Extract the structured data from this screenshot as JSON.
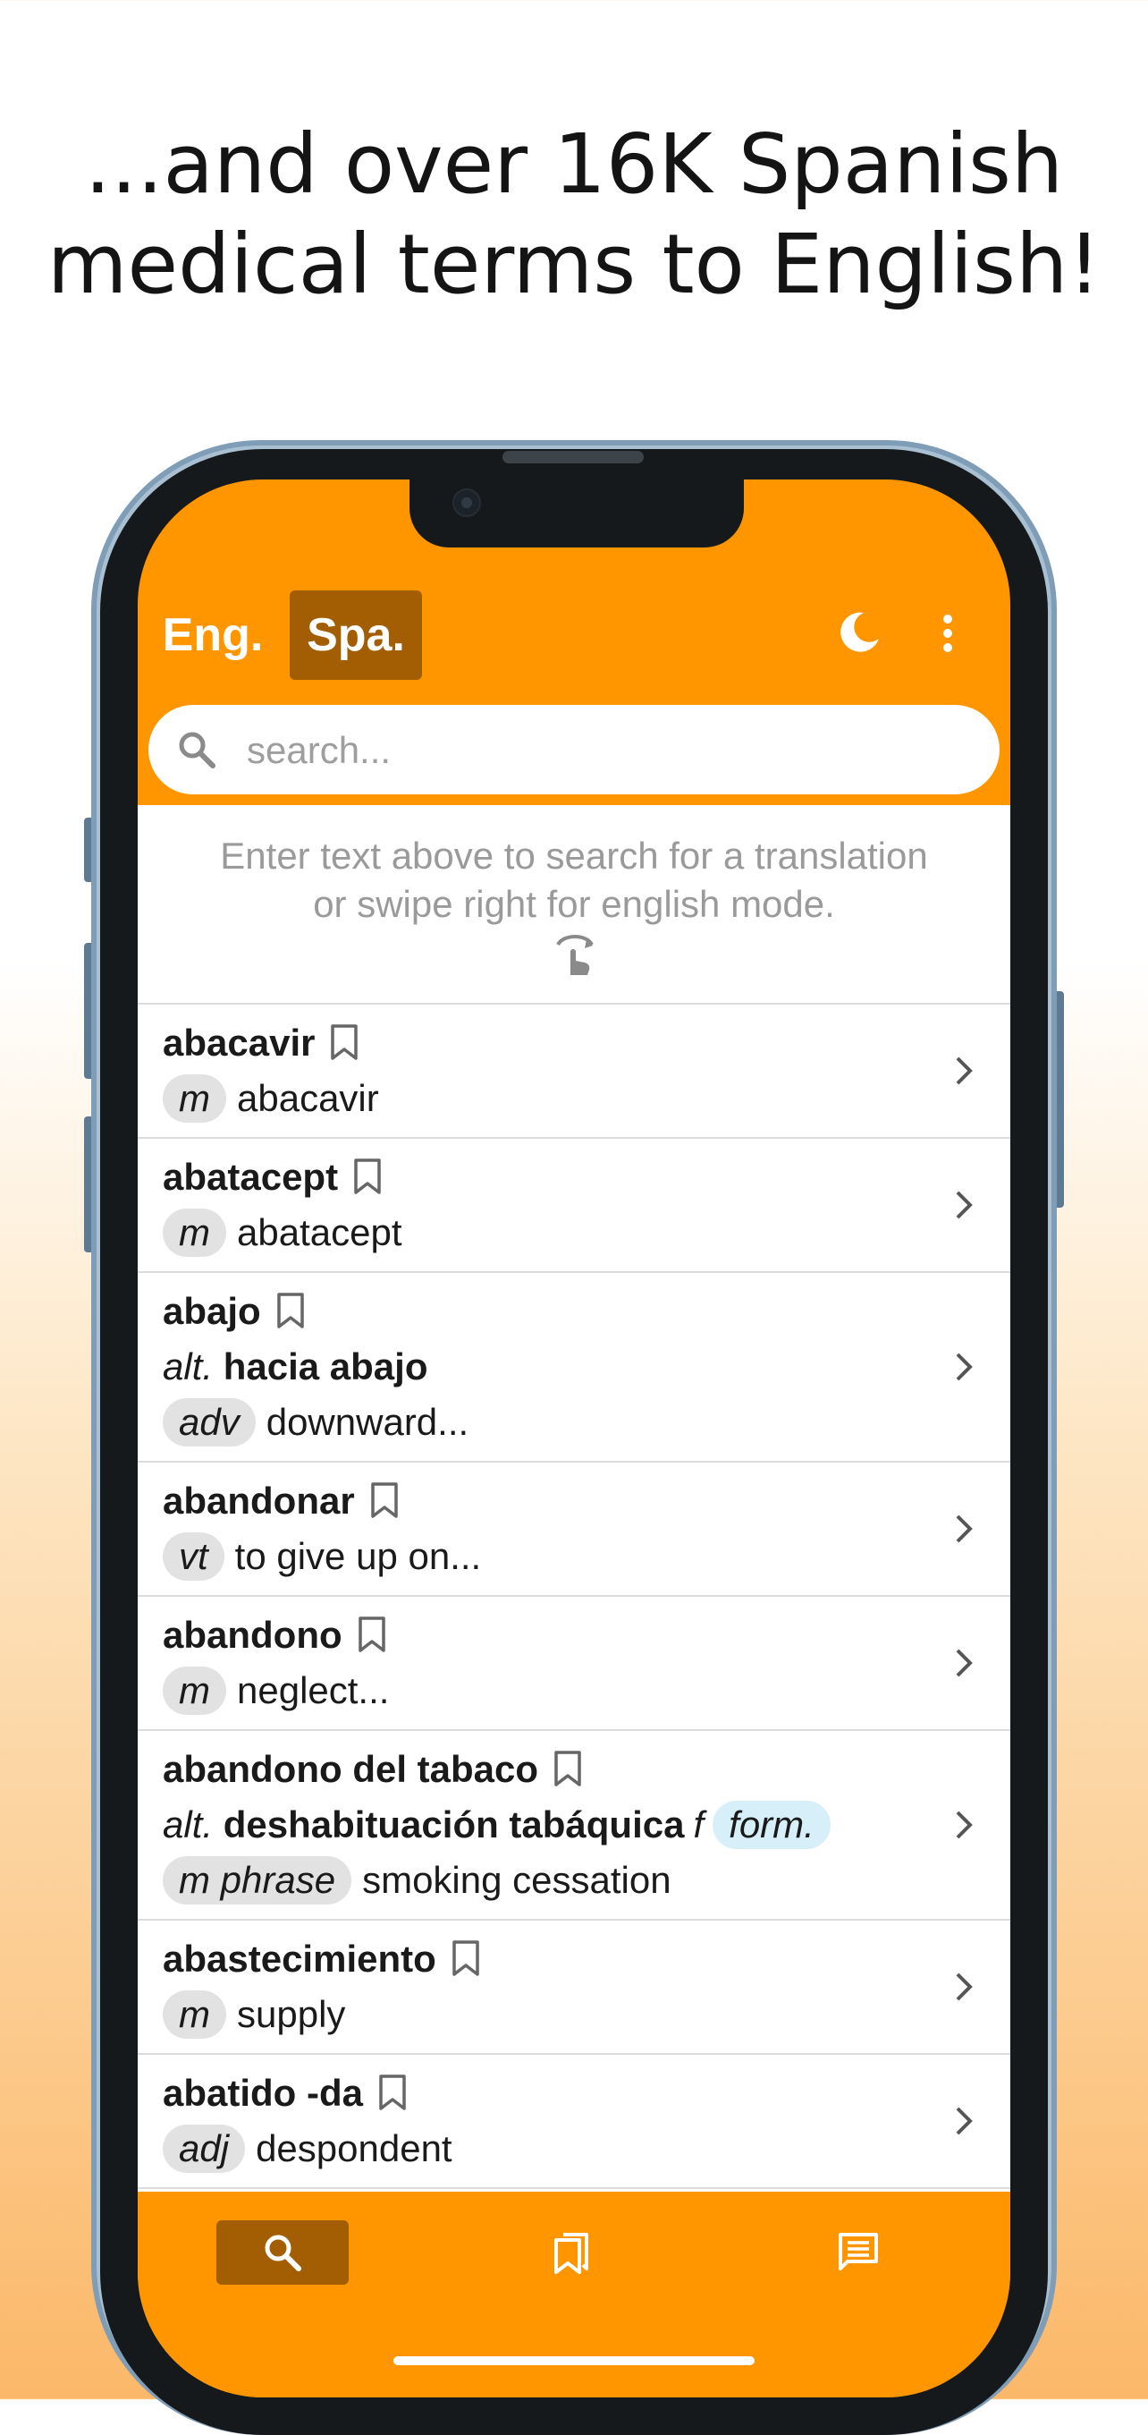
{
  "headline": {
    "line1": "...and over 16K Spanish",
    "line2": "medical terms to English!"
  },
  "appbar": {
    "tab_eng": "Eng.",
    "tab_spa": "Spa.",
    "active_tab": "Spa.",
    "theme_icon": "moon-icon",
    "menu_icon": "more-vert-icon"
  },
  "search": {
    "placeholder": "search...",
    "value": ""
  },
  "hint": {
    "line1": "Enter text above to search for a translation",
    "line2": "or swipe right for english mode.",
    "icon": "swipe-gesture-icon"
  },
  "entries": [
    {
      "term": "abacavir",
      "pos": "m",
      "translation": "abacavir"
    },
    {
      "term": "abatacept",
      "pos": "m",
      "translation": "abatacept"
    },
    {
      "term": "abajo",
      "alt_label": "alt.",
      "alt_term": "hacia abajo",
      "pos": "adv",
      "translation": "downward..."
    },
    {
      "term": "abandonar",
      "pos": "vt",
      "translation": "to give up on..."
    },
    {
      "term": "abandono",
      "pos": "m",
      "translation": "neglect..."
    },
    {
      "term": "abandono del tabaco",
      "alt_label": "alt.",
      "alt_term": "deshabituación tabáquica",
      "alt_gender": "f",
      "alt_register": "form.",
      "pos": "m phrase",
      "translation": "smoking cessation"
    },
    {
      "term": "abastecimiento",
      "pos": "m",
      "translation": "supply"
    },
    {
      "term": "abatido -da",
      "pos": "adj",
      "translation": "despondent"
    }
  ],
  "bottom_nav": {
    "items": [
      "search-icon",
      "bookmarks-icon",
      "comments-icon"
    ],
    "active": "search-icon"
  },
  "colors": {
    "accent": "#ff9600",
    "accent_dark": "#a35e04",
    "pill": "#e2e2e2",
    "register_pill": "#d6eff9"
  }
}
